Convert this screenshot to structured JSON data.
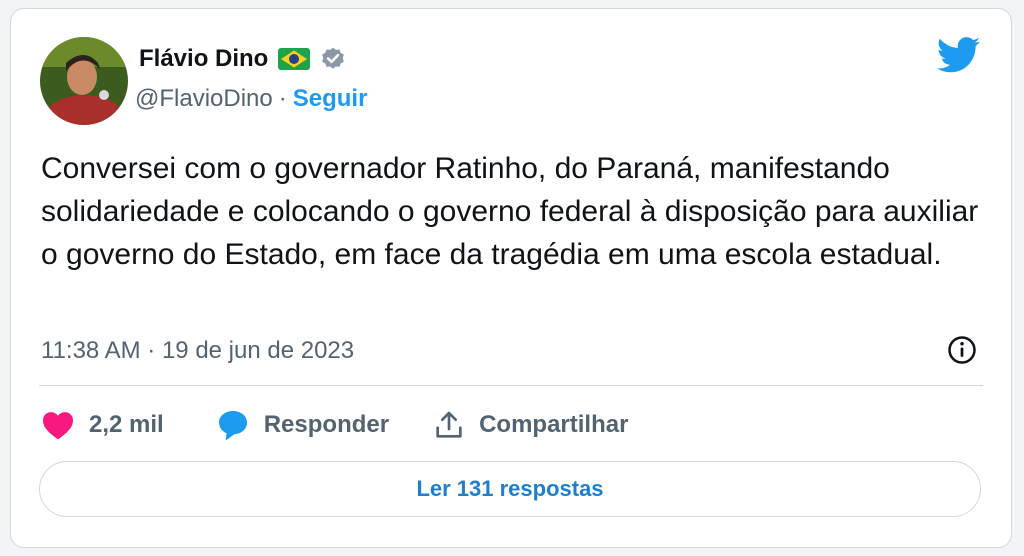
{
  "author": {
    "name": "Flávio Dino",
    "handle": "@FlavioDino",
    "separator": "·",
    "follow_label": "Seguir",
    "flag_icon": "brazil-flag-icon",
    "verified_icon": "verified-badge-icon"
  },
  "tweet": {
    "text": "Conversei com o governador Ratinho, do Paraná, manifestando solidariedade e colocando o governo federal à disposição para auxiliar o governo do Estado, em face da tragédia em uma escola estadual.",
    "timestamp": "11:38 AM · 19 de jun de 2023"
  },
  "actions": {
    "likes_count": "2,2 mil",
    "reply_label": "Responder",
    "share_label": "Compartilhar"
  },
  "read_replies_label": "Ler 131 respostas",
  "colors": {
    "accent": "#1d9bf0",
    "heart": "#f91880",
    "text": "#0f1419",
    "muted": "#536471",
    "border": "#cfd9de"
  }
}
